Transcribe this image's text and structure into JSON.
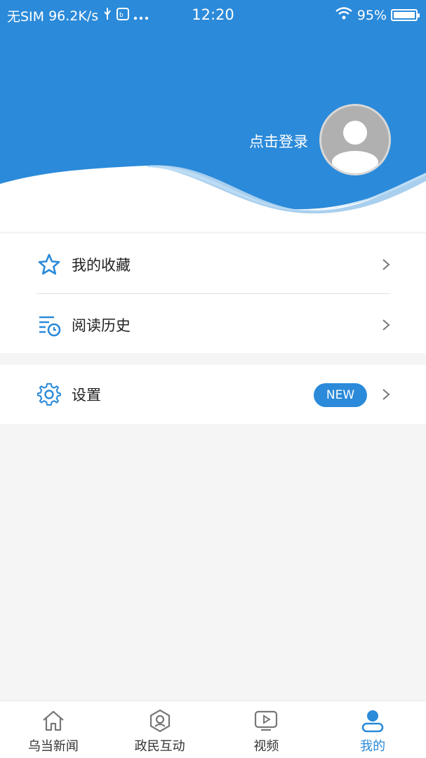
{
  "status_bar": {
    "carrier": "无SIM",
    "speed": "96.2K/s",
    "time": "12:20",
    "battery": "95%"
  },
  "header": {
    "login_label": "点击登录",
    "accent_color": "#2b8ad9"
  },
  "menu": {
    "favorites_label": "我的收藏",
    "history_label": "阅读历史",
    "settings_label": "设置",
    "settings_badge": "NEW"
  },
  "tabbar": {
    "items": [
      {
        "label": "乌当新闻",
        "icon": "home-icon"
      },
      {
        "label": "政民互动",
        "icon": "interaction-icon"
      },
      {
        "label": "视频",
        "icon": "video-icon"
      },
      {
        "label": "我的",
        "icon": "profile-icon"
      }
    ],
    "active_index": 3
  }
}
